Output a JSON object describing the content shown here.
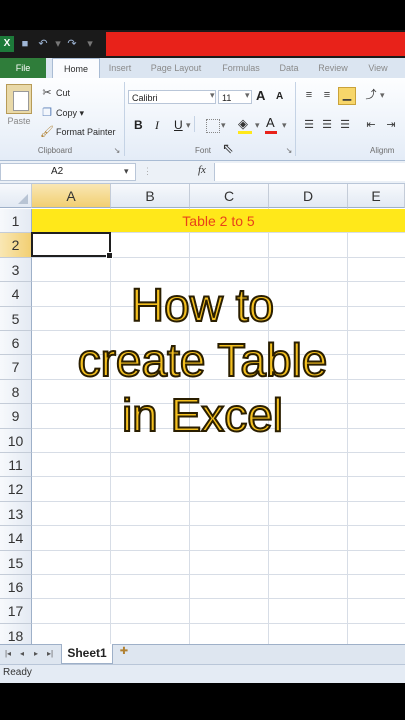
{
  "titlebar": {
    "logo_glyph": "X",
    "save_glyph": "💾",
    "undo_glyph": "↶",
    "redo_glyph": "↷",
    "redbar_color": "#e8221a"
  },
  "ribbon_tabs": {
    "file": "File",
    "home": "Home",
    "insert": "Insert",
    "page_layout": "Page Layout",
    "formulas": "Formulas",
    "data": "Data",
    "review": "Review",
    "view": "View"
  },
  "clipboard": {
    "paste_label": "Paste",
    "cut_label": "Cut",
    "copy_label": "Copy ▾",
    "format_painter_label": "Format Painter",
    "group_label": "Clipboard"
  },
  "font": {
    "font_name": "Calibri",
    "font_size": "11",
    "bold": "B",
    "italic": "I",
    "underline": "U",
    "grow": "A",
    "shrink": "A",
    "font_color_glyph": "A",
    "group_label": "Font"
  },
  "alignment": {
    "group_label": "Alignm"
  },
  "formula_bar": {
    "name_box": "A2",
    "fx": "fx",
    "value": ""
  },
  "columns": [
    "A",
    "B",
    "C",
    "D",
    "E"
  ],
  "rows": [
    "1",
    "2",
    "3",
    "4",
    "5",
    "6",
    "7",
    "8",
    "9",
    "10",
    "11",
    "12",
    "13",
    "14",
    "15",
    "16",
    "17",
    "18"
  ],
  "cells": {
    "A1": "Table 2 to 5",
    "header_fill": "#ffe81a",
    "text_color": "#e8421a"
  },
  "overlay": {
    "line1": "How to",
    "line2": "create Table",
    "line3": "in Excel",
    "color": "#f4c020"
  },
  "sheet_tabs": {
    "first": "◂",
    "prev": "◂",
    "next": "▸",
    "last": "▸",
    "sheet1": "Sheet1"
  },
  "status": {
    "text": "Ready"
  }
}
